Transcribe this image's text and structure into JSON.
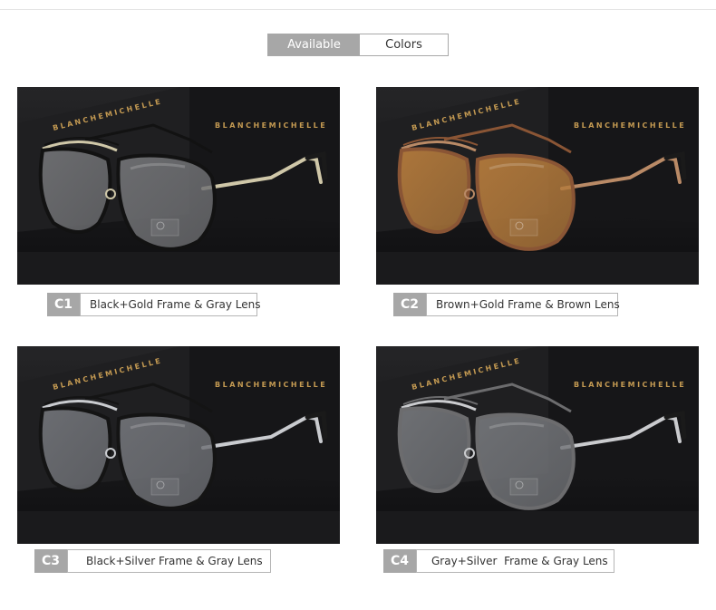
{
  "header": {
    "available_label": "Available",
    "colors_label": "Colors"
  },
  "brand_text": "BLANCHEMICHELLE",
  "products": [
    {
      "code": "C1",
      "description": "Black+Gold Frame & Gray Lens",
      "frame_color": "#121212",
      "temple_color": "#cfc7a8",
      "lens_color": "#6f7073"
    },
    {
      "code": "C2",
      "description": "Brown+Gold Frame & Brown Lens",
      "frame_color": "#8a5535",
      "temple_color": "#b98a66",
      "lens_color": "#b37a3c"
    },
    {
      "code": "C3",
      "description": "Black+Silver Frame & Gray Lens",
      "frame_color": "#141414",
      "temple_color": "#c9cbcf",
      "lens_color": "#6f7176"
    },
    {
      "code": "C4",
      "description": "Gray+Silver  Frame & Gray Lens",
      "frame_color": "#6c6c6e",
      "temple_color": "#cacbce",
      "lens_color": "#727478"
    }
  ],
  "colors": {
    "label_bg": "#a7a7a7",
    "brand_gold": "#c49a52",
    "box_black": "#1a1a1c"
  }
}
